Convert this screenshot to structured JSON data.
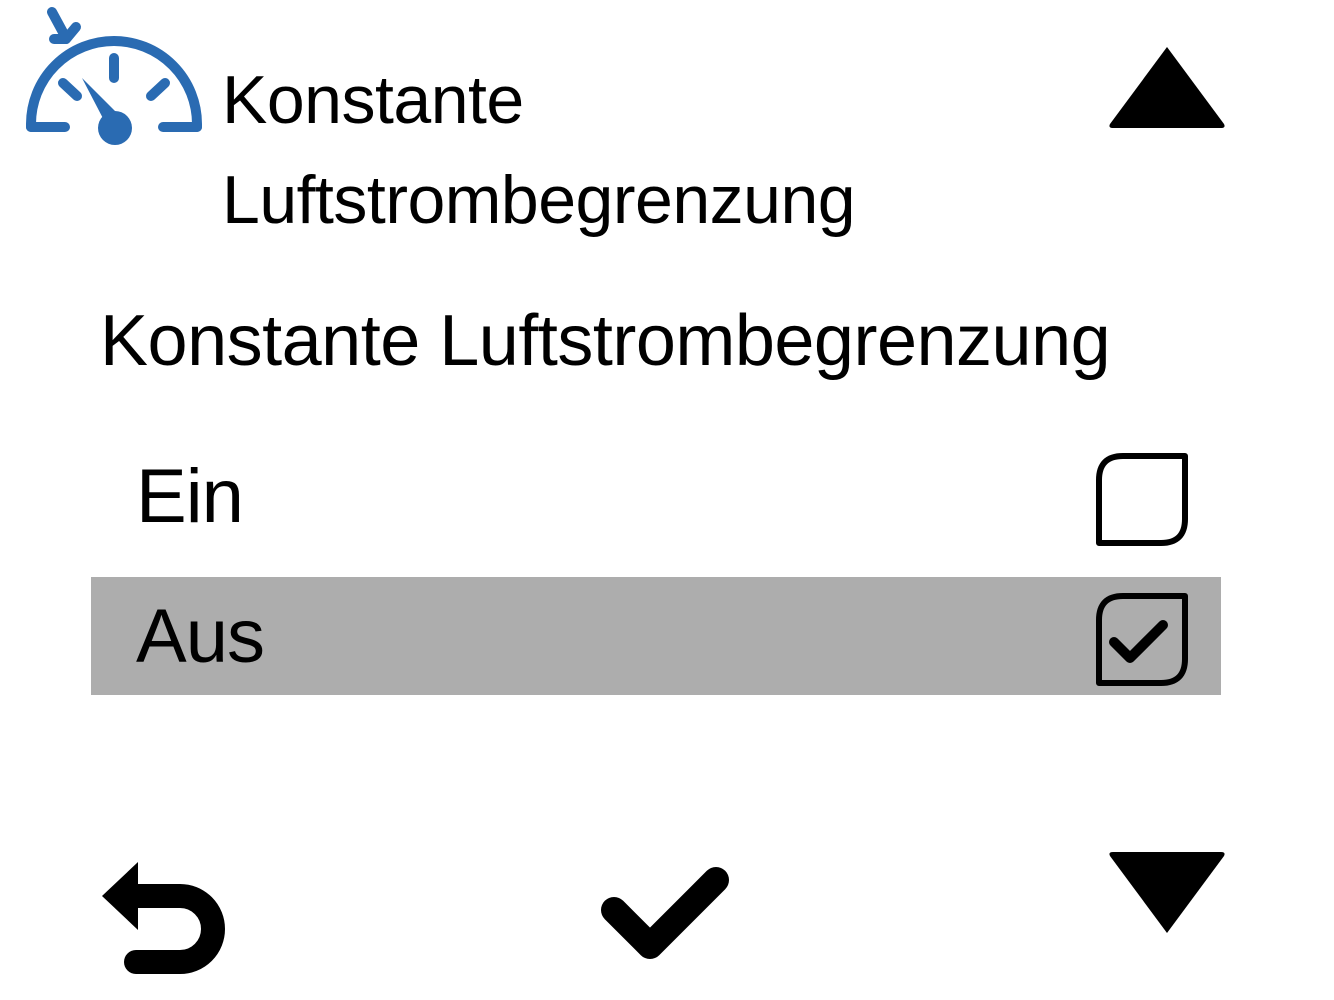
{
  "header": {
    "title": "Konstante\nLuftstrombegrenzung",
    "icon": "speedometer-limit-icon",
    "icon_color": "#2a6bb2"
  },
  "navigation": {
    "up_icon": "triangle-up-icon",
    "down_icon": "triangle-down-icon"
  },
  "section": {
    "title": "Konstante Luftstrombegrenzung"
  },
  "options": [
    {
      "label": "Ein",
      "checked": false
    },
    {
      "label": "Aus",
      "checked": true
    }
  ],
  "footer": {
    "back_icon": "back-arrow-icon",
    "confirm_icon": "checkmark-icon"
  },
  "colors": {
    "selection_highlight": "#adadad",
    "text": "#000000",
    "accent": "#2a6bb2"
  }
}
